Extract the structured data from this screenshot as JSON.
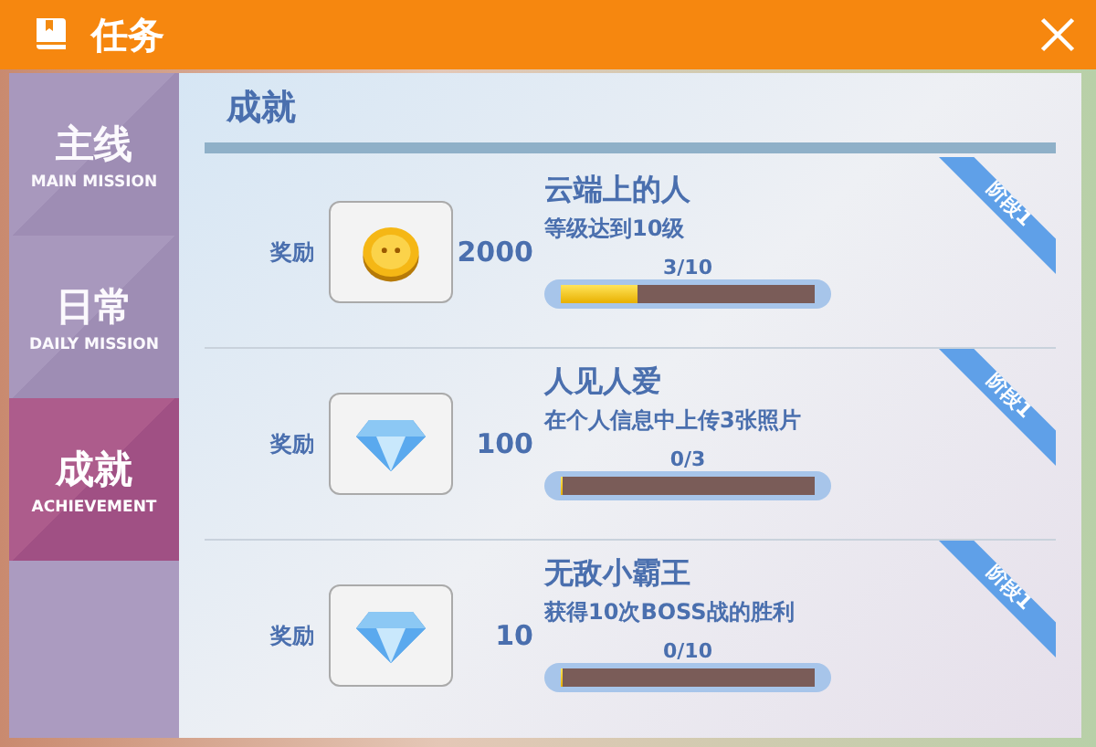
{
  "window": {
    "title": "任务"
  },
  "tabs": [
    {
      "label": "主线",
      "sublabel": "MAIN MISSION",
      "selected": false
    },
    {
      "label": "日常",
      "sublabel": "DAILY MISSION",
      "selected": false
    },
    {
      "label": "成就",
      "sublabel": "ACHIEVEMENT",
      "selected": true
    }
  ],
  "section_title": "成就",
  "achievements": [
    {
      "reward_label": "奖励",
      "kind": "coin",
      "amount": "2000",
      "title": "云端上的人",
      "description": "等级达到10级",
      "progress": "3/10",
      "level": 0.3,
      "badge": "阶段1"
    },
    {
      "reward_label": "奖励",
      "kind": "diamond",
      "amount": "100",
      "title": "人见人爱",
      "description": "在个人信息中上传3张照片",
      "progress": "0/3",
      "level": 0,
      "badge": "阶段1"
    },
    {
      "reward_label": "奖励",
      "kind": "diamond",
      "amount": "10",
      "title": "无敌小霸王",
      "description": "获得10次BOSS战的胜利",
      "progress": "0/10",
      "level": 0,
      "badge": "阶段1"
    }
  ]
}
